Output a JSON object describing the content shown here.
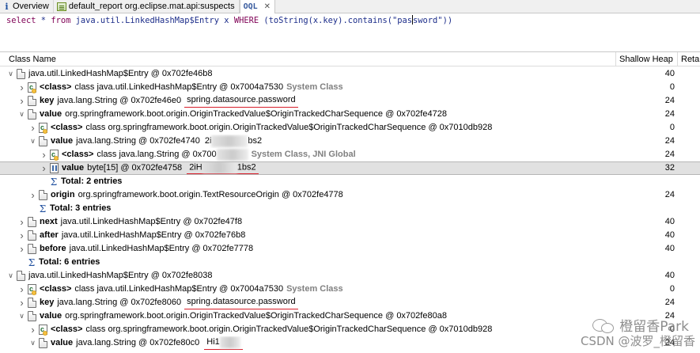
{
  "tabs": [
    {
      "icon": "info-icon",
      "glyph": "i",
      "label": "Overview"
    },
    {
      "icon": "report-icon",
      "label": "default_report  org.eclipse.mat.api:suspects"
    },
    {
      "icon": "oql-icon",
      "glyph": "OQL",
      "label": "OQL",
      "close": "✕"
    }
  ],
  "query": {
    "kw1": "select",
    "p1": " * ",
    "kw2": "from",
    "p2": " java.util.LinkedHashMap$Entry x ",
    "kw3": "WHERE",
    "p3": " (toString(x.key).contains(\"pas",
    "p4": "sword\"))"
  },
  "columns": {
    "name": "Class Name",
    "heap": "Shallow Heap",
    "retained": "Reta"
  },
  "rows": [
    {
      "lvl": 0,
      "tw": "v",
      "icon": "object",
      "label": "",
      "text": "java.util.LinkedHashMap$Entry @ 0x702fe46b8",
      "sys": "",
      "ul": "",
      "heap": "40"
    },
    {
      "lvl": 1,
      "tw": ">",
      "icon": "class",
      "label": "<class>",
      "text": "class java.util.LinkedHashMap$Entry @ 0x7004a7530",
      "sys": "System Class",
      "ul": "",
      "heap": "0"
    },
    {
      "lvl": 1,
      "tw": ">",
      "icon": "object",
      "label": "key",
      "text": "java.lang.String @ 0x702fe46e0",
      "sys": "",
      "ul": "spring.datasource.password",
      "heap": "24"
    },
    {
      "lvl": 1,
      "tw": "v",
      "icon": "object",
      "label": "value",
      "text": "org.springframework.boot.origin.OriginTrackedValue$OriginTrackedCharSequence @ 0x702fe4728",
      "sys": "",
      "ul": "",
      "heap": "24"
    },
    {
      "lvl": 2,
      "tw": ">",
      "icon": "class",
      "label": "<class>",
      "text": "class org.springframework.boot.origin.OriginTrackedValue$OriginTrackedCharSequence @ 0x7010db928",
      "sys": "",
      "ul": "",
      "heap": "0"
    },
    {
      "lvl": 2,
      "tw": "v",
      "icon": "object",
      "label": "value",
      "text": "java.lang.String @ 0x702fe4740",
      "sys": "",
      "ul": "",
      "blur": "2i",
      "tail": "bs2",
      "heap": "24"
    },
    {
      "lvl": 3,
      "tw": ">",
      "icon": "class",
      "label": "<class>",
      "text": "class java.lang.String @ 0x700",
      "blur2": "",
      "sys": "System Class, JNI Global",
      "ul": "",
      "heap": "24"
    },
    {
      "lvl": 3,
      "tw": ">",
      "icon": "array",
      "label": "value",
      "text": "byte[15] @ 0x702fe4758",
      "sys": "",
      "ul": "",
      "blurul": "2iH",
      "tailul": "1bs2",
      "heap": "32",
      "selected": true
    },
    {
      "lvl": 3,
      "tw": "",
      "icon": "sum",
      "label": "Total: 2 entries",
      "text": "",
      "sys": "",
      "ul": "",
      "heap": ""
    },
    {
      "lvl": 2,
      "tw": ">",
      "icon": "object",
      "label": "origin",
      "text": "org.springframework.boot.origin.TextResourceOrigin @ 0x702fe4778",
      "sys": "",
      "ul": "",
      "heap": "24"
    },
    {
      "lvl": 2,
      "tw": "",
      "icon": "sum",
      "label": "Total: 3 entries",
      "text": "",
      "sys": "",
      "ul": "",
      "heap": ""
    },
    {
      "lvl": 1,
      "tw": ">",
      "icon": "object",
      "label": "next",
      "text": "java.util.LinkedHashMap$Entry @ 0x702fe47f8",
      "sys": "",
      "ul": "",
      "heap": "40"
    },
    {
      "lvl": 1,
      "tw": ">",
      "icon": "object",
      "label": "after",
      "text": "java.util.LinkedHashMap$Entry @ 0x702fe76b8",
      "sys": "",
      "ul": "",
      "heap": "40"
    },
    {
      "lvl": 1,
      "tw": ">",
      "icon": "object",
      "label": "before",
      "text": "java.util.LinkedHashMap$Entry @ 0x702fe7778",
      "sys": "",
      "ul": "",
      "heap": "40"
    },
    {
      "lvl": 1,
      "tw": "",
      "icon": "sum",
      "label": "Total: 6 entries",
      "text": "",
      "sys": "",
      "ul": "",
      "heap": ""
    },
    {
      "lvl": 0,
      "tw": "v",
      "icon": "object",
      "label": "",
      "text": "java.util.LinkedHashMap$Entry @ 0x702fe8038",
      "sys": "",
      "ul": "",
      "heap": "40"
    },
    {
      "lvl": 1,
      "tw": ">",
      "icon": "class",
      "label": "<class>",
      "text": "class java.util.LinkedHashMap$Entry @ 0x7004a7530",
      "sys": "System Class",
      "ul": "",
      "heap": "0"
    },
    {
      "lvl": 1,
      "tw": ">",
      "icon": "object",
      "label": "key",
      "text": "java.lang.String @ 0x702fe8060",
      "sys": "",
      "ul": "spring.datasource.password",
      "heap": "24"
    },
    {
      "lvl": 1,
      "tw": "v",
      "icon": "object",
      "label": "value",
      "text": "org.springframework.boot.origin.OriginTrackedValue$OriginTrackedCharSequence @ 0x702fe80a8",
      "sys": "",
      "ul": "",
      "heap": "24"
    },
    {
      "lvl": 2,
      "tw": ">",
      "icon": "class",
      "label": "<class>",
      "text": "class org.springframework.boot.origin.OriginTrackedValue$OriginTrackedCharSequence @ 0x7010db928",
      "sys": "",
      "ul": "",
      "heap": "0"
    },
    {
      "lvl": 2,
      "tw": "v",
      "icon": "object",
      "label": "value",
      "text": "java.lang.String @ 0x702fe80c0",
      "sys": "",
      "ul": "",
      "blurul": "Hi1",
      "tailul": "",
      "heap": "24"
    }
  ],
  "watermark": {
    "line1": "橙留香Park",
    "line2": "CSDN @波罗_橙留香"
  },
  "colors": {
    "keyword": "#7f0055",
    "query_text": "#1c2d8a",
    "underline": "#d81e2a",
    "system_class": "#808080",
    "selected_row": "#e1e1e1"
  }
}
